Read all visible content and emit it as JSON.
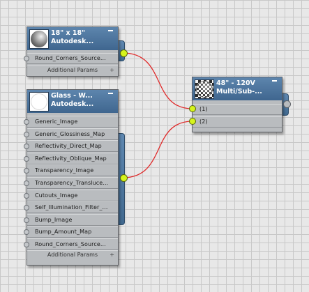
{
  "nodes": {
    "tile": {
      "title_line1": "18\" x 18\"",
      "title_line2": "Autodesk...",
      "slots": [
        "Round_Corners_Source..."
      ],
      "additional_params": "Additional Params"
    },
    "glass": {
      "title_line1": "Glass - W...",
      "title_line2": "Autodesk...",
      "slots": [
        "Generic_Image",
        "Generic_Glossiness_Map",
        "Reflectivity_Direct_Map",
        "Reflectivity_Oblique_Map",
        "Transparency_Image",
        "Transparency_Transluce...",
        "Cutouts_Image",
        "Self_Illumination_Filter_...",
        "Bump_Image",
        "Bump_Amount_Map",
        "Round_Corners_Source..."
      ],
      "additional_params": "Additional Params"
    },
    "multi": {
      "title_line1": "48\" - 120V",
      "title_line2": "Multi/Sub-...",
      "slots": [
        "(1)",
        "(2)"
      ]
    }
  },
  "icons": {
    "collapse": "minus-icon",
    "expand": "plus-icon",
    "output_socket": "circle-socket-icon",
    "input_pin": "circle-pin-icon"
  },
  "colors": {
    "header": "#4a729b",
    "body": "#b9bcbf",
    "connected": "#d6f41c",
    "wire": "#e02a2a",
    "grid_bg": "#e8e8e8"
  },
  "ui": {
    "plus_glyph": "+"
  }
}
